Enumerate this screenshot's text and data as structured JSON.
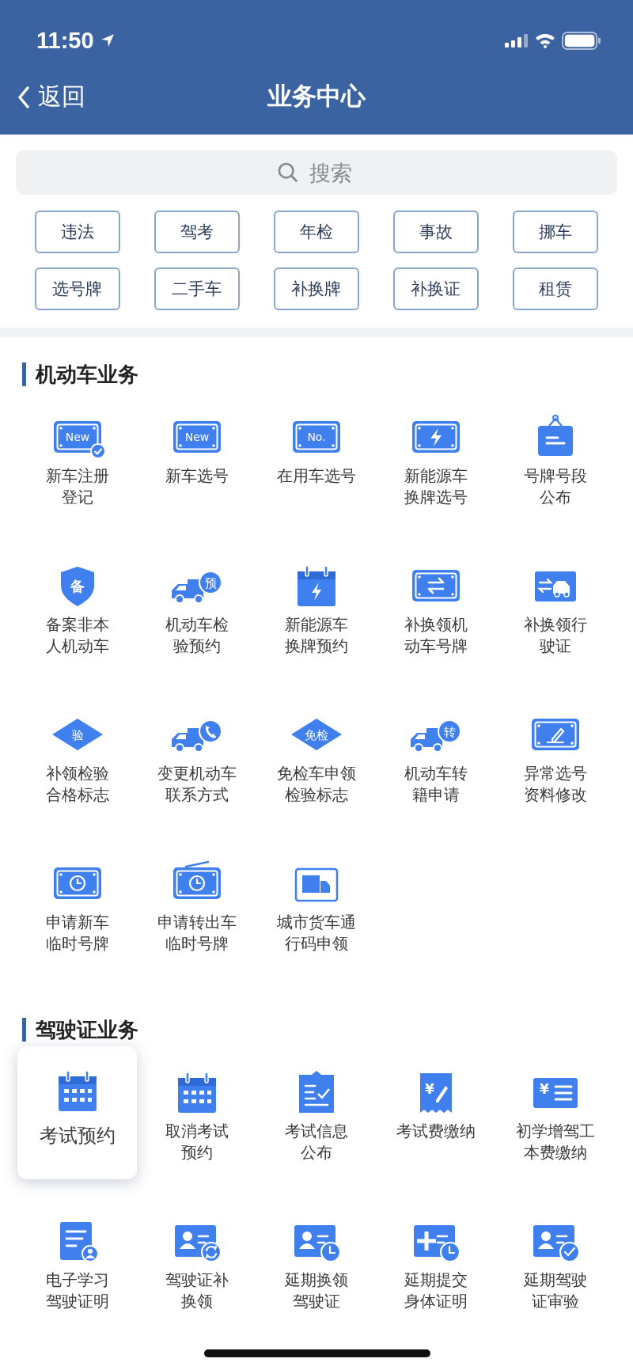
{
  "status_bar": {
    "time": "11:50"
  },
  "nav": {
    "back": "返回",
    "title": "业务中心"
  },
  "search": {
    "placeholder": "搜索"
  },
  "quick_tags": [
    "违法",
    "驾考",
    "年检",
    "事故",
    "挪车",
    "选号牌",
    "二手车",
    "补换牌",
    "补换证",
    "租赁"
  ],
  "sections": [
    {
      "title": "机动车业务",
      "items": [
        {
          "label": "新车注册登记",
          "kind": "plate_text",
          "icon_text": "New",
          "check": true,
          "selected": false
        },
        {
          "label": "新车选号",
          "kind": "plate_text",
          "icon_text": "New",
          "check": false,
          "selected": false
        },
        {
          "label": "在用车选号",
          "kind": "plate_text",
          "icon_text": "No.",
          "check": false,
          "selected": false
        },
        {
          "label": "新能源车换牌选号",
          "kind": "plate_bolt",
          "selected": false
        },
        {
          "label": "号牌号段公布",
          "kind": "sign",
          "selected": false
        },
        {
          "label": "备案非本人机动车",
          "kind": "shield_text",
          "icon_text": "备",
          "selected": false
        },
        {
          "label": "机动车检验预约",
          "kind": "truck_text",
          "icon_text": "预",
          "selected": false
        },
        {
          "label": "新能源车换牌预约",
          "kind": "calendar_bolt",
          "selected": false
        },
        {
          "label": "补换领机动车号牌",
          "kind": "plate_swap",
          "selected": false
        },
        {
          "label": "补换领行驶证",
          "kind": "card_car",
          "selected": false
        },
        {
          "label": "补领检验合格标志",
          "kind": "diamond_text",
          "icon_text": "验",
          "selected": false
        },
        {
          "label": "变更机动车联系方式",
          "kind": "truck_phone",
          "selected": false
        },
        {
          "label": "免检车申领检验标志",
          "kind": "diamond_text",
          "icon_text": "免检",
          "selected": false
        },
        {
          "label": "机动车转籍申请",
          "kind": "truck_text",
          "icon_text": "转",
          "selected": false
        },
        {
          "label": "异常选号资料修改",
          "kind": "plate_pen",
          "selected": false
        },
        {
          "label": "申请新车临时号牌",
          "kind": "plate_clock",
          "selected": false
        },
        {
          "label": "申请转出车临时号牌",
          "kind": "plate_clock_radio",
          "selected": false
        },
        {
          "label": "城市货车通行码申领",
          "kind": "van",
          "selected": false
        }
      ]
    },
    {
      "title": "驾驶证业务",
      "items": [
        {
          "label": "考试预约",
          "kind": "calendar_grid",
          "selected": true
        },
        {
          "label": "取消考试预约",
          "kind": "calendar_grid",
          "selected": false
        },
        {
          "label": "考试信息公布",
          "kind": "notice_check",
          "selected": false
        },
        {
          "label": "考试费缴纳",
          "kind": "receipt_text",
          "icon_text": "¥",
          "selected": false
        },
        {
          "label": "初学增驾工本费缴纳",
          "kind": "bill_text",
          "icon_text": "¥",
          "selected": false
        },
        {
          "label": "电子学习驾驶证明",
          "kind": "doc_user",
          "selected": false
        },
        {
          "label": "驾驶证补换领",
          "kind": "card_swap",
          "selected": false
        },
        {
          "label": "延期换领驾驶证",
          "kind": "card_clock",
          "selected": false
        },
        {
          "label": "延期提交身体证明",
          "kind": "plus_clock",
          "selected": false
        },
        {
          "label": "延期驾驶证审验",
          "kind": "card_check",
          "selected": false
        }
      ]
    }
  ]
}
